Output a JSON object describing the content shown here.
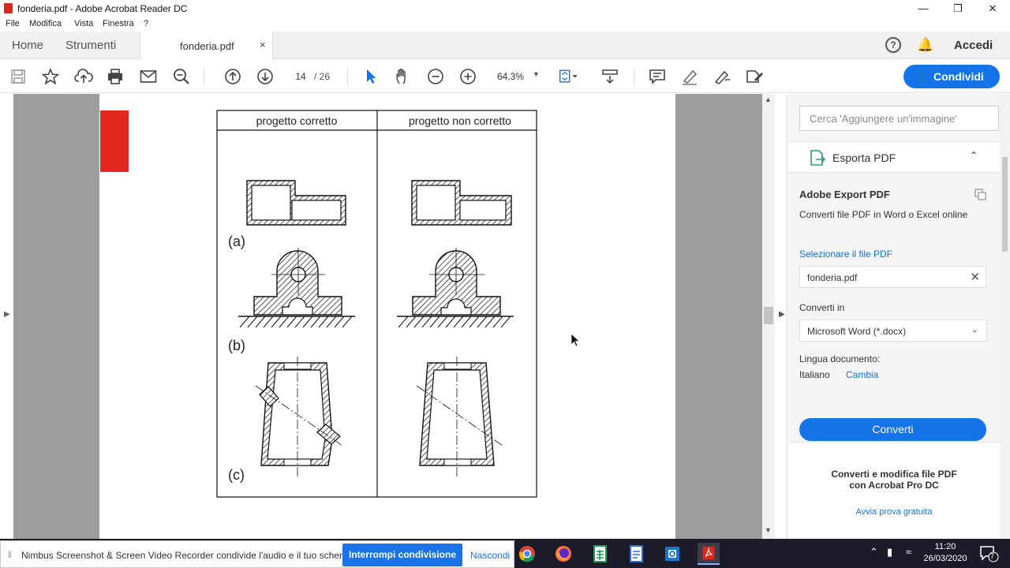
{
  "window": {
    "title": "fonderia.pdf - Adobe Acrobat Reader DC",
    "controls": [
      "—",
      "❐",
      "✕"
    ]
  },
  "menu": [
    "File",
    "Modifica",
    "Vista",
    "Finestra",
    "?"
  ],
  "tabs": {
    "home": "Home",
    "tools": "Strumenti",
    "document": "fonderia.pdf",
    "close": "×"
  },
  "header_right": {
    "help": "?",
    "signin": "Accedi"
  },
  "toolbar": {
    "page_current": "14",
    "page_total": "/ 26",
    "zoom": "64,3%",
    "share_label": "Condividi"
  },
  "document": {
    "figure": {
      "col_left": "progetto corretto",
      "col_right": "progetto non corretto",
      "label_a": "(a)",
      "label_b": "(b)",
      "label_c": "(c)"
    }
  },
  "right_pane": {
    "search_placeholder": "Cerca 'Aggiungere un'immagine'",
    "section_title": "Esporta PDF",
    "panel_title": "Adobe Export PDF",
    "panel_desc": "Converti file PDF in Word o Excel online",
    "select_file_label": "Selezionare il file PDF",
    "file_value": "fonderia.pdf",
    "convert_in_label": "Converti in",
    "convert_in_value": "Microsoft Word (*.docx)",
    "language_label": "Lingua documento:",
    "language_value": "Italiano",
    "language_change": "Cambia",
    "convert_button": "Converti",
    "promo_line1": "Converti e modifica file PDF",
    "promo_line2": "con Acrobat Pro DC",
    "promo_link": "Avvia prova gratuita"
  },
  "share_bar": {
    "message": "Nimbus Screenshot & Screen Video Recorder condivide l'audio e il tuo schermo.",
    "stop_button": "Interrompi condivisione",
    "hide_button": "Nascondi"
  },
  "taskbar": {
    "time": "11:20",
    "date": "26/03/2020",
    "notification_count": "7"
  },
  "colors": {
    "accent": "#1473e6",
    "red_tab": "#e42621",
    "taskbar": "#1b1b2a"
  }
}
